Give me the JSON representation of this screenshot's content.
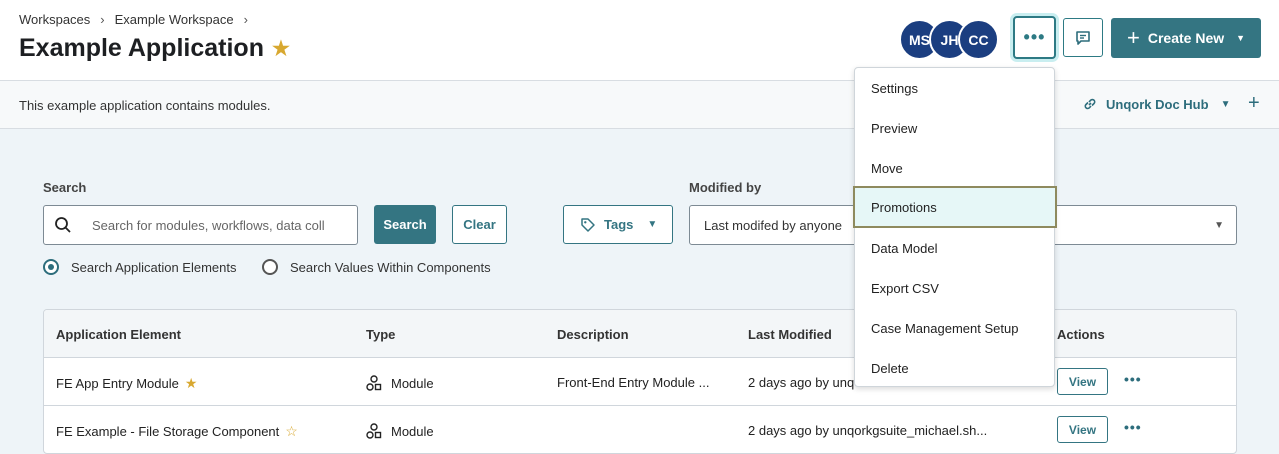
{
  "breadcrumb": {
    "items": [
      "Workspaces",
      "Example Workspace"
    ]
  },
  "page": {
    "title": "Example Application",
    "description": "This example application contains modules."
  },
  "avatars": [
    "MS",
    "JH",
    "CC"
  ],
  "header": {
    "more_label": "•••",
    "create_label": "Create New"
  },
  "doc_hub": {
    "label": "Unqork Doc Hub"
  },
  "search": {
    "label": "Search",
    "placeholder": "Search for modules, workflows, data coll",
    "search_button": "Search",
    "clear_button": "Clear",
    "tags_label": "Tags",
    "radio_application": "Search Application Elements",
    "radio_components": "Search Values Within Components"
  },
  "modified_by": {
    "label": "Modified by",
    "value": "Last modifed by anyone"
  },
  "table": {
    "headers": [
      "Application Element",
      "Type",
      "Description",
      "Last Modified",
      "Actions"
    ],
    "rows": [
      {
        "name": "FE App Entry Module",
        "starred": true,
        "type": "Module",
        "description": "Front-End Entry Module ...",
        "modified": "2 days ago by unq",
        "view": "View"
      },
      {
        "name": "FE Example - File Storage Component",
        "starred": false,
        "type": "Module",
        "description": "",
        "modified": "2 days ago by unqorkgsuite_michael.sh...",
        "view": "View"
      }
    ]
  },
  "menu": {
    "items": [
      "Settings",
      "Preview",
      "Move",
      "Promotions",
      "Data Model",
      "Export CSV",
      "Case Management Setup",
      "Delete"
    ],
    "active": "Promotions"
  },
  "colors": {
    "accent": "#347582",
    "avatar": "#1b3e80",
    "star": "#d8a830"
  }
}
